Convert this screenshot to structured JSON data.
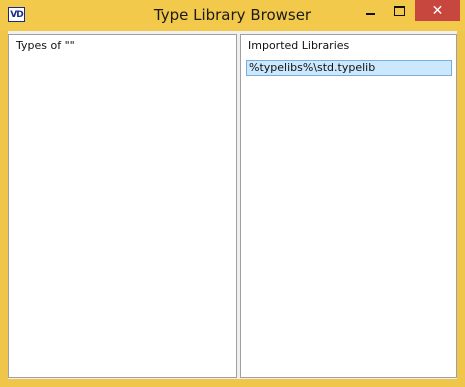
{
  "window": {
    "title": "Type Library Browser",
    "icon_text": "VD",
    "controls": {
      "minimize": "minimize",
      "maximize": "maximize",
      "close_label": "✕"
    }
  },
  "left_pane": {
    "header": "Types of \"\""
  },
  "right_pane": {
    "header": "Imported Libraries",
    "items": [
      "%typelibs%\\std.typelib"
    ]
  },
  "colors": {
    "titlebar": "#f2c94a",
    "close_button": "#c7463d",
    "selection": "#cce8ff"
  }
}
